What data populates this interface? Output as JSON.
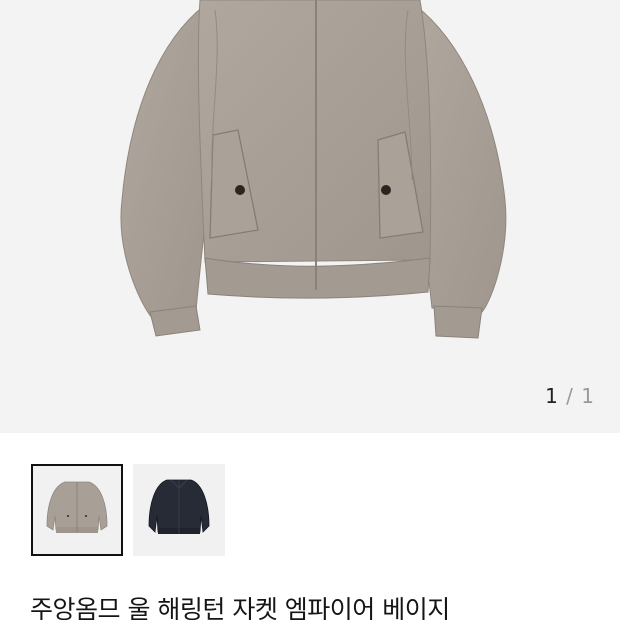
{
  "gallery": {
    "current_page": "1",
    "separator": "/",
    "total_pages": "1"
  },
  "thumbnails": [
    {
      "label": "beige-jacket-thumbnail",
      "color": "#a59c93"
    },
    {
      "label": "navy-jacket-thumbnail",
      "color": "#262b36"
    }
  ],
  "product": {
    "title": "주앙옴므 울 해링턴 자켓 엠파이어 베이지"
  },
  "colors": {
    "jacket_beige": "#a8a097",
    "hero_background": "#f3f3f3"
  }
}
